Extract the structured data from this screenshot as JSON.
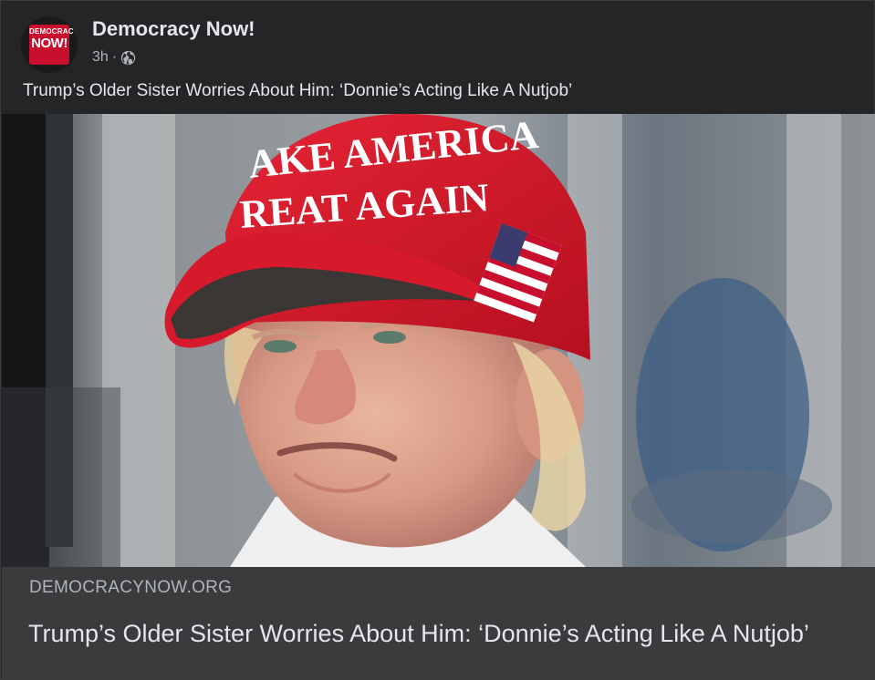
{
  "post": {
    "page_name": "Democracy Now!",
    "time": "3h",
    "separator": "·",
    "privacy_icon": "globe-icon",
    "caption": "Trump’s Older Sister Worries About Him: ‘Donnie’s Acting Like A Nutjob’",
    "avatar": {
      "logo_small": "DEMOCRACY",
      "logo_big": "NOW!",
      "brand_color": "#c8102e"
    }
  },
  "image": {
    "description_icon": "photo",
    "hat_text_line1": "AKE AMERICA",
    "hat_text_line2": "REAT AGAIN"
  },
  "link_preview": {
    "domain": "DEMOCRACYNOW.ORG",
    "title": "Trump’s Older Sister Worries About Him: ‘Donnie’s Acting Like A Nutjob’"
  },
  "colors": {
    "background": "#242526",
    "preview_bg": "#3a3b3c",
    "text_primary": "#e4e6eb",
    "text_secondary": "#b0b3b8",
    "hat_red": "#d5182a"
  }
}
